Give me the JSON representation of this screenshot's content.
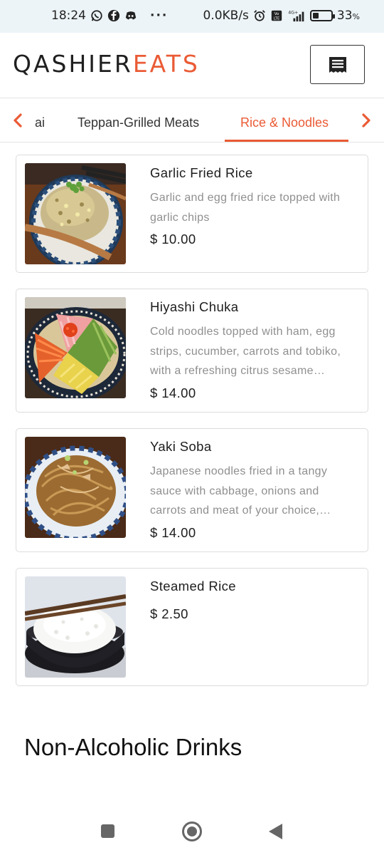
{
  "status_bar": {
    "time": "18:24",
    "left_icons": [
      "whatsapp-icon",
      "facebook-icon",
      "discord-icon"
    ],
    "more": "···",
    "net_speed": "0.0KB/s",
    "right_icons": [
      "alarm-icon",
      "volte-icon",
      "signal-4g-icon"
    ],
    "battery_level": 0.33,
    "battery_text": "33",
    "battery_unit": "%"
  },
  "header": {
    "logo_part1": "QASHIER",
    "logo_part2": "EATS",
    "menu_icon": "receipt-icon"
  },
  "tabs": {
    "items": [
      {
        "label": "ai",
        "active": false
      },
      {
        "label": "Teppan-Grilled Meats",
        "active": false
      },
      {
        "label": "Rice & Noodles",
        "active": true
      }
    ]
  },
  "menu_items": [
    {
      "name": "Garlic Fried Rice",
      "desc_lines": [
        "Garlic and egg fried rice topped with",
        "garlic chips"
      ],
      "price": "$ 10.00"
    },
    {
      "name": "Hiyashi Chuka",
      "desc_lines": [
        "Cold noodles topped with ham, egg",
        "strips, cucumber, carrots and tobiko,",
        "with a refreshing citrus sesame…"
      ],
      "price": "$ 14.00"
    },
    {
      "name": "Yaki Soba",
      "desc_lines": [
        "Japanese noodles fried in a tangy",
        "sauce with cabbage, onions and",
        "carrots and meat of your choice,…"
      ],
      "price": "$ 14.00"
    },
    {
      "name": "Steamed Rice",
      "desc_lines": [],
      "price": "$ 2.50"
    }
  ],
  "next_section_title": "Non-Alcoholic Drinks",
  "colors": {
    "accent": "#ea5b35",
    "status_bg": "#ecf4f7",
    "text_dark": "#1d1d1d",
    "text_muted": "#8f8f8f"
  }
}
